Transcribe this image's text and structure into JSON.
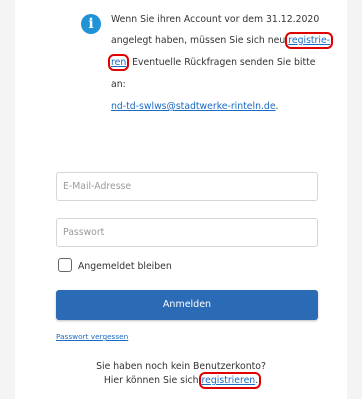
{
  "info": {
    "line1": "Wenn Sie ihren Account vor dem 31.12.2020",
    "line2_text": "angelegt haben, müssen Sie sich neu ",
    "line2_link": "registrie-",
    "line3_link": "ren",
    "line3_text": ". Eventuelle Rückfragen senden Sie bitte",
    "line4": "an:",
    "email": "nd-td-swlws@stadtwerke-rinteln.de",
    "email_suffix": "."
  },
  "form": {
    "email_placeholder": "E-Mail-Adresse",
    "password_placeholder": "Passwort",
    "remember_label": "Angemeldet bleiben",
    "login_button": "Anmelden",
    "forgot_password": "Passwort vergessen"
  },
  "register": {
    "line1": "Sie haben noch kein Benutzerkonto?",
    "line2_text": "Hier können Sie sich ",
    "line2_link": "registrieren",
    "line2_suffix": "."
  },
  "colors": {
    "accent": "#2b6bb5",
    "link": "#1a6bc4",
    "info_icon": "#1f93d6",
    "highlight": "#e00000"
  },
  "icons": {
    "info": "info-icon"
  }
}
